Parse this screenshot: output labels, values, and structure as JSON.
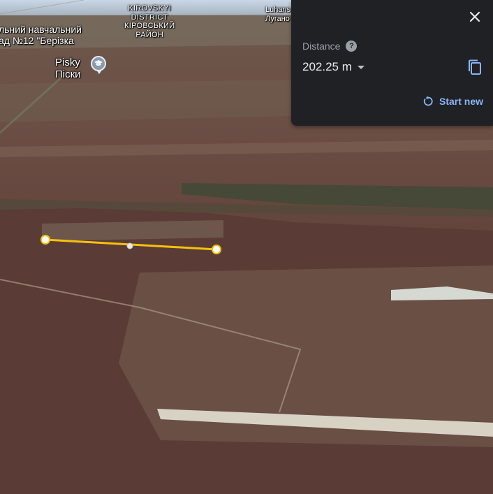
{
  "map": {
    "labels": {
      "school_line1": "льний навчальний",
      "school_line2": "ад №12 \"Берізка",
      "district_line1": "KIROVSKYI",
      "district_line2": "DISTRICT",
      "district_line3": "КІРОВСЬКИЙ",
      "district_line4": "РАЙОН",
      "pisky_en": "Pisky",
      "pisky_uk": "Піски",
      "luhansk_line1": "Luhans",
      "luhansk_line2": "Лугано"
    },
    "pin_icon": "school-icon",
    "measure_line_color": "#f4c20d"
  },
  "panel": {
    "distance_label": "Distance",
    "distance_value": "202.25 m",
    "start_new_label": "Start new",
    "accent_color": "#8ab4f8"
  }
}
